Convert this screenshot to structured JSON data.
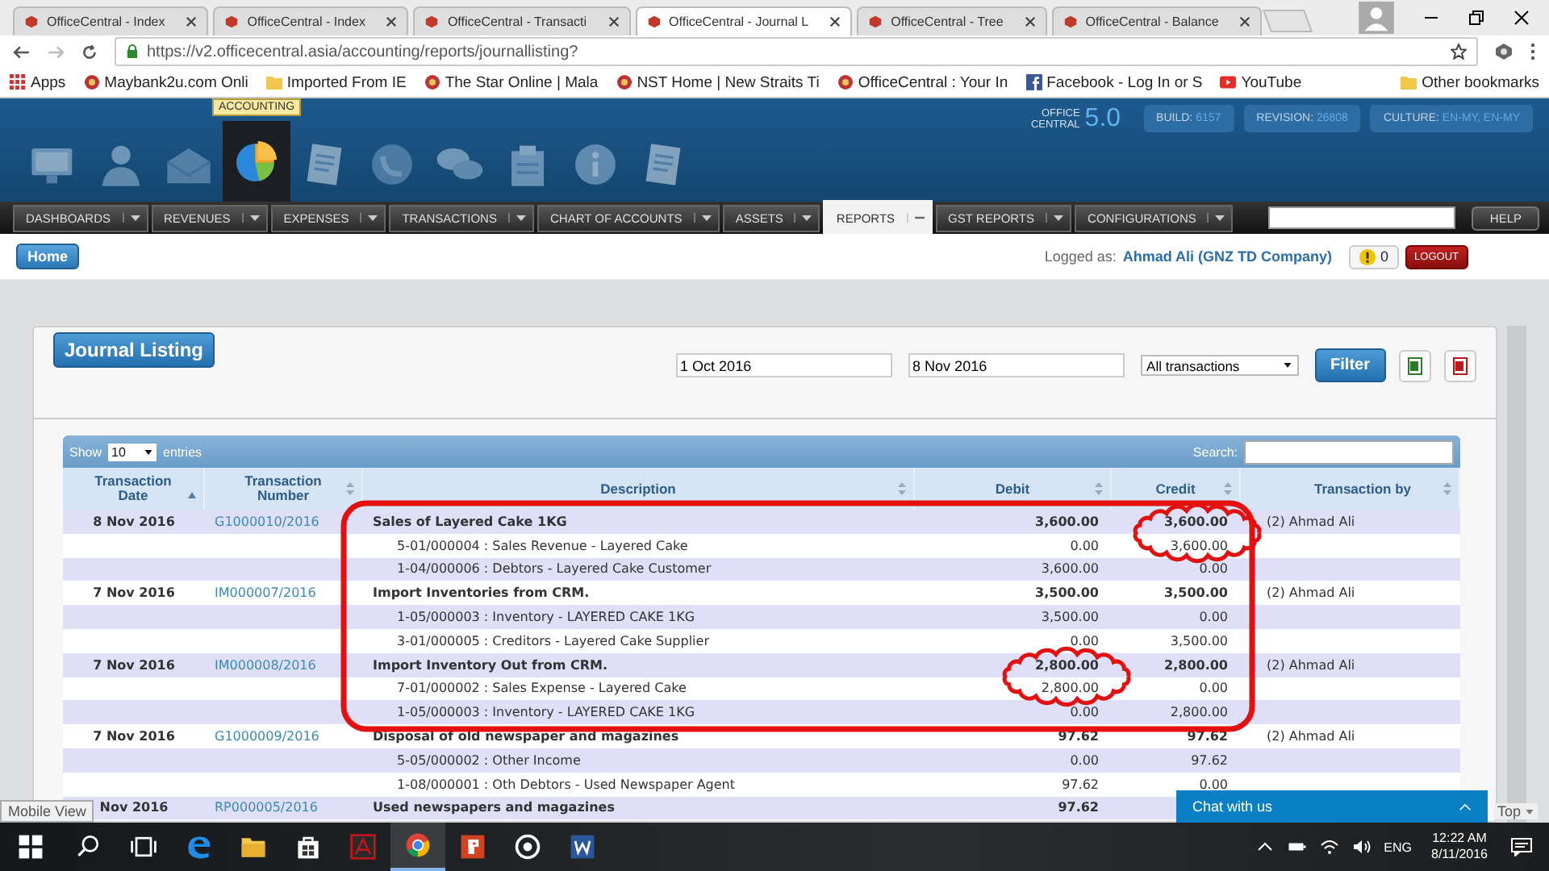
{
  "browser": {
    "tabs": [
      {
        "title": "OfficeCentral - Index",
        "selected": false
      },
      {
        "title": "OfficeCentral - Index",
        "selected": false
      },
      {
        "title": "OfficeCentral - Transacti",
        "selected": false
      },
      {
        "title": "OfficeCentral - Journal L",
        "selected": true
      },
      {
        "title": "OfficeCentral - Tree",
        "selected": false
      },
      {
        "title": "OfficeCentral - Balance",
        "selected": false
      }
    ],
    "url": "https://v2.officecentral.asia/accounting/reports/journallisting?",
    "bookmarks": [
      {
        "label": "Apps",
        "kind": "apps"
      },
      {
        "label": "Maybank2u.com Onli",
        "kind": "site"
      },
      {
        "label": "Imported From IE",
        "kind": "folder"
      },
      {
        "label": "The Star Online | Mala",
        "kind": "site"
      },
      {
        "label": "NST Home | New Straits Ti",
        "kind": "site"
      },
      {
        "label": "OfficeCentral : Your In",
        "kind": "site"
      },
      {
        "label": "Facebook - Log In or S",
        "kind": "facebook"
      },
      {
        "label": "YouTube",
        "kind": "youtube"
      }
    ],
    "other_bookmarks": "Other bookmarks"
  },
  "app_header": {
    "modules": [
      {
        "kind": "monitor",
        "selected": false
      },
      {
        "kind": "person",
        "selected": false
      },
      {
        "kind": "envelope",
        "selected": false
      },
      {
        "kind": "pie",
        "selected": true
      },
      {
        "kind": "document",
        "selected": false
      },
      {
        "kind": "phone",
        "selected": false
      },
      {
        "kind": "chat",
        "selected": false
      },
      {
        "kind": "clipboard",
        "selected": false
      },
      {
        "kind": "info",
        "selected": false
      },
      {
        "kind": "document",
        "selected": false
      }
    ],
    "tooltip": "ACCOUNTING",
    "logo_lines": [
      "OFFICE",
      "CENTRAL"
    ],
    "version": "5.0",
    "info": [
      {
        "label": "BUILD:",
        "value": "6157"
      },
      {
        "label": "REVISION:",
        "value": "26808"
      },
      {
        "label": "CULTURE:",
        "value": "EN-MY, EN-MY"
      }
    ]
  },
  "menu": {
    "items": [
      {
        "label": "DASHBOARDS",
        "selected": false
      },
      {
        "label": "REVENUES",
        "selected": false
      },
      {
        "label": "EXPENSES",
        "selected": false
      },
      {
        "label": "TRANSACTIONS",
        "selected": false
      },
      {
        "label": "CHART OF ACCOUNTS",
        "selected": false
      },
      {
        "label": "ASSETS",
        "selected": false
      },
      {
        "label": "REPORTS",
        "selected": true
      },
      {
        "label": "GST REPORTS",
        "selected": false
      },
      {
        "label": "CONFIGURATIONS",
        "selected": false
      }
    ],
    "help": "HELP"
  },
  "userbar": {
    "home": "Home",
    "logged_prefix": "Logged as:",
    "user": "Ahmad Ali (GNZ TD Company)",
    "alerts": "0",
    "logout": "LOGOUT"
  },
  "journal": {
    "title": "Journal Listing",
    "from": "1 Oct 2016",
    "to": "8 Nov 2016",
    "type": "All transactions",
    "filter": "Filter",
    "table": {
      "show_label": "Show",
      "page_size": "10",
      "entries_label": "entries",
      "search_label": "Search:",
      "columns": [
        {
          "label": "Transaction Date",
          "sorted": true
        },
        {
          "label": "Transaction Number",
          "sorted": false
        },
        {
          "label": "Description",
          "sorted": false
        },
        {
          "label": "Debit",
          "sorted": false
        },
        {
          "label": "Credit",
          "sorted": false
        },
        {
          "label": "Transaction by",
          "sorted": false
        }
      ],
      "rows": [
        {
          "kind": "entry",
          "date": "8 Nov 2016",
          "number": "G1000010/2016",
          "description": "Sales of Layered Cake 1KG",
          "debit": "3,600.00",
          "credit": "3,600.00",
          "by": "(2) Ahmad Ali"
        },
        {
          "kind": "line",
          "description": "5-01/000004 : Sales Revenue - Layered Cake",
          "debit": "0.00",
          "credit": "3,600.00"
        },
        {
          "kind": "line",
          "description": "1-04/000006 : Debtors - Layered Cake Customer",
          "debit": "3,600.00",
          "credit": "0.00"
        },
        {
          "kind": "entry",
          "date": "7 Nov 2016",
          "number": "IM000007/2016",
          "description": "Import Inventories from CRM.",
          "debit": "3,500.00",
          "credit": "3,500.00",
          "by": "(2) Ahmad Ali"
        },
        {
          "kind": "line",
          "description": "1-05/000003 : Inventory - LAYERED CAKE 1KG",
          "debit": "3,500.00",
          "credit": "0.00"
        },
        {
          "kind": "line",
          "description": "3-01/000005 : Creditors - Layered Cake Supplier",
          "debit": "0.00",
          "credit": "3,500.00"
        },
        {
          "kind": "entry",
          "date": "7 Nov 2016",
          "number": "IM000008/2016",
          "description": "Import Inventory Out from CRM.",
          "debit": "2,800.00",
          "credit": "2,800.00",
          "by": "(2) Ahmad Ali"
        },
        {
          "kind": "line",
          "description": "7-01/000002 : Sales Expense - Layered Cake",
          "debit": "2,800.00",
          "credit": "0.00"
        },
        {
          "kind": "line",
          "description": "1-05/000003 : Inventory - LAYERED CAKE 1KG",
          "debit": "0.00",
          "credit": "2,800.00"
        },
        {
          "kind": "entry",
          "date": "7 Nov 2016",
          "number": "G1000009/2016",
          "description": "Disposal of old newspaper and magazines",
          "debit": "97.62",
          "credit": "97.62",
          "by": "(2) Ahmad Ali"
        },
        {
          "kind": "line",
          "description": "5-05/000002 : Other Income",
          "debit": "0.00",
          "credit": "97.62"
        },
        {
          "kind": "line",
          "description": "1-08/000001 : Oth Debtors - Used Newspaper Agent",
          "debit": "97.62",
          "credit": "0.00"
        },
        {
          "kind": "entry",
          "date": "Nov 2016",
          "number": "RP000005/2016",
          "description": "Used newspapers and magazines",
          "debit": "97.62"
        }
      ]
    }
  },
  "overlays": {
    "mobile_view": "Mobile View",
    "chat": "Chat with us",
    "top": "Top"
  },
  "taskbar": {
    "apps": [
      {
        "kind": "start",
        "selected": false
      },
      {
        "kind": "search",
        "selected": false
      },
      {
        "kind": "taskview",
        "selected": false
      },
      {
        "kind": "edge",
        "selected": false
      },
      {
        "kind": "folder",
        "selected": false
      },
      {
        "kind": "store",
        "selected": false
      },
      {
        "kind": "acrobat",
        "selected": false
      },
      {
        "kind": "chrome",
        "selected": true
      },
      {
        "kind": "powerpoint",
        "selected": false
      },
      {
        "kind": "groove",
        "selected": false
      },
      {
        "kind": "word",
        "selected": false
      }
    ],
    "language": "ENG",
    "time": "12:22 AM",
    "date": "8/11/2016"
  }
}
